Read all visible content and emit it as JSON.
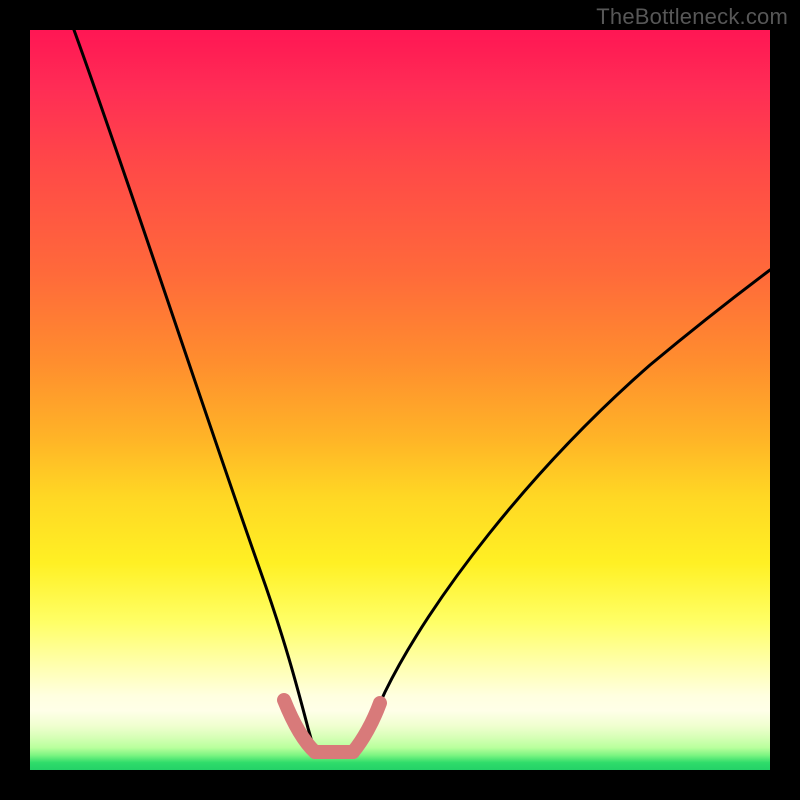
{
  "watermark": "TheBottleneck.com",
  "chart_data": {
    "type": "line",
    "title": "",
    "xlabel": "",
    "ylabel": "",
    "xlim": [
      0,
      100
    ],
    "ylim": [
      0,
      100
    ],
    "series": [
      {
        "name": "left-curve",
        "x": [
          6,
          10,
          14,
          18,
          22,
          26,
          30,
          32,
          34,
          36,
          37.5,
          38.3
        ],
        "y": [
          100,
          87,
          73,
          60,
          46,
          33,
          20,
          14,
          9,
          5,
          2.8,
          2.5
        ]
      },
      {
        "name": "right-curve",
        "x": [
          44.3,
          46,
          50,
          55,
          62,
          70,
          80,
          90,
          100
        ],
        "y": [
          2.5,
          4,
          9,
          15,
          24,
          34,
          45,
          55,
          64
        ]
      },
      {
        "name": "left-pink-segment",
        "x": [
          34.3,
          36,
          37,
          38,
          38.5
        ],
        "y": [
          9.5,
          5.2,
          3.6,
          2.8,
          2.5
        ]
      },
      {
        "name": "bottom-pink-segment",
        "x": [
          38.5,
          40,
          42,
          43.7
        ],
        "y": [
          2.5,
          2.4,
          2.4,
          2.5
        ]
      },
      {
        "name": "right-pink-segment",
        "x": [
          43.7,
          45,
          46,
          47.3
        ],
        "y": [
          2.5,
          3.8,
          5.8,
          9
        ]
      }
    ],
    "colors": {
      "curve": "#000000",
      "highlight": "#d87a7a",
      "gradient_top": "#ff1654",
      "gradient_mid": "#ffd724",
      "gradient_bottom": "#24d268"
    }
  }
}
